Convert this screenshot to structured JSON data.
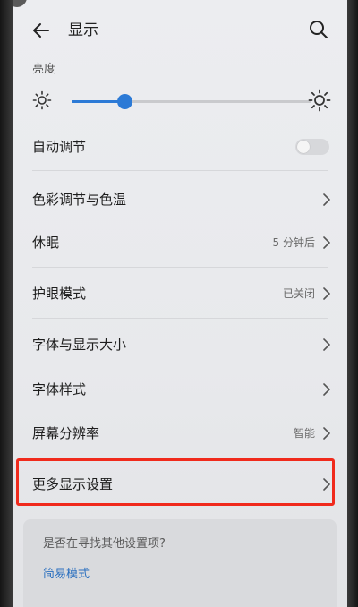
{
  "header": {
    "title": "显示",
    "back_icon": "back-arrow-icon",
    "search_icon": "search-icon"
  },
  "brightness": {
    "label": "亮度",
    "level_fraction": 0.22,
    "accent_color": "#2c7ad6"
  },
  "settings": {
    "auto_adjust": {
      "label": "自动调节",
      "enabled": false
    },
    "color_temp": {
      "label": "色彩调节与色温"
    },
    "sleep": {
      "label": "休眠",
      "value": "5 分钟后"
    },
    "eye_comfort": {
      "label": "护眼模式",
      "value": "已关闭"
    },
    "font_size": {
      "label": "字体与显示大小"
    },
    "font_style": {
      "label": "字体样式"
    },
    "resolution": {
      "label": "屏幕分辨率",
      "value": "智能"
    },
    "more_display": {
      "label": "更多显示设置"
    }
  },
  "suggestion": {
    "question": "是否在寻找其他设置项?",
    "link": "简易模式"
  },
  "highlight_color": "#f02a1c"
}
